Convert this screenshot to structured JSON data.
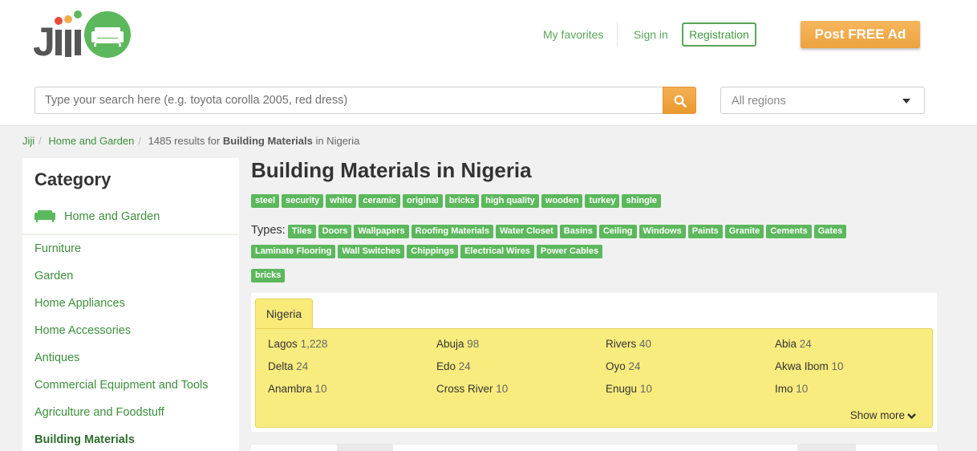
{
  "header": {
    "logo_text": "Jiji",
    "nav": {
      "favorites": "My favorites",
      "sign_in": "Sign in",
      "registration": "Registration"
    },
    "post_ad": "Post FREE Ad",
    "search": {
      "placeholder": "Type your search here (e.g. toyota corolla 2005, red dress)",
      "value": ""
    },
    "region_select": "All regions",
    "brand_colors": {
      "green": "#5aa45a",
      "orange": "#f0ad4e"
    }
  },
  "breadcrumb": {
    "items": [
      "Jiji",
      "Home and Garden"
    ],
    "results_prefix": "1485 results for",
    "results_category": "Building Materials",
    "results_suffix": "in Nigeria"
  },
  "sidebar": {
    "title": "Category",
    "parent": "Home and Garden",
    "items": [
      {
        "label": "Furniture"
      },
      {
        "label": "Garden"
      },
      {
        "label": "Home Appliances"
      },
      {
        "label": "Home Accessories"
      },
      {
        "label": "Antiques"
      },
      {
        "label": "Commercial Equipment and Tools"
      },
      {
        "label": "Agriculture and Foodstuff"
      },
      {
        "label": "Building Materials",
        "active": true
      }
    ]
  },
  "main": {
    "title": "Building Materials in Nigeria",
    "tags": [
      "steel",
      "security",
      "white",
      "ceramic",
      "original",
      "bricks",
      "high quality",
      "wooden",
      "turkey",
      "shingle"
    ],
    "types_label": "Types:",
    "types": [
      "Tiles",
      "Doors",
      "Wallpapers",
      "Roofing Materials",
      "Water Closet",
      "Basins",
      "Ceiling",
      "Windows",
      "Paints",
      "Granite",
      "Cements",
      "Gates",
      "Laminate Flooring",
      "Wall Switches",
      "Chippings",
      "Electrical Wires",
      "Power Cables"
    ],
    "extra_tag": "bricks"
  },
  "regions": {
    "tab": "Nigeria",
    "list": [
      {
        "name": "Lagos",
        "count": "1,228"
      },
      {
        "name": "Abuja",
        "count": "98"
      },
      {
        "name": "Rivers",
        "count": "40"
      },
      {
        "name": "Abia",
        "count": "24"
      },
      {
        "name": "Delta",
        "count": "24"
      },
      {
        "name": "Edo",
        "count": "24"
      },
      {
        "name": "Oyo",
        "count": "24"
      },
      {
        "name": "Akwa Ibom",
        "count": "10"
      },
      {
        "name": "Anambra",
        "count": "10"
      },
      {
        "name": "Cross River",
        "count": "10"
      },
      {
        "name": "Enugu",
        "count": "10"
      },
      {
        "name": "Imo",
        "count": "10"
      }
    ],
    "show_more": "Show more"
  }
}
